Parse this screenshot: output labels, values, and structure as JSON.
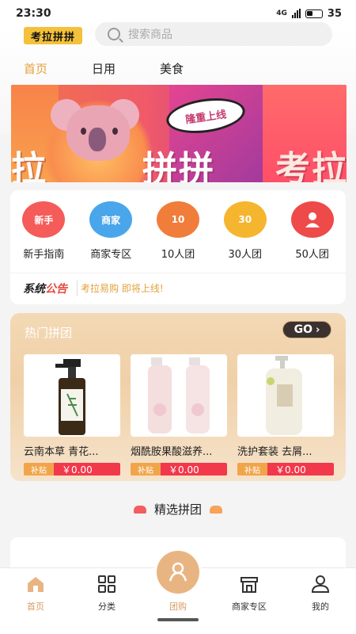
{
  "status_bar": {
    "time": "23:30",
    "network": "4G",
    "battery": "35"
  },
  "header": {
    "logo": "考拉拼拼",
    "search_placeholder": "搜索商品",
    "tabs": [
      {
        "label": "首页",
        "active": true
      },
      {
        "label": "日用",
        "active": false
      },
      {
        "label": "美食",
        "active": false
      }
    ]
  },
  "banner": {
    "bubble_text": "隆重上线",
    "text_left": "拉",
    "text_mid": "拼拼",
    "text_right": "考拉"
  },
  "categories": [
    {
      "label": "新手指南",
      "icon_text": "新手",
      "color": "#f45b59"
    },
    {
      "label": "商家专区",
      "icon_text": "商家",
      "color": "#4aa6ea"
    },
    {
      "label": "10人团",
      "icon_text": "10",
      "color": "#f07d3a"
    },
    {
      "label": "30人团",
      "icon_text": "30",
      "color": "#f5b52e"
    },
    {
      "label": "50人团",
      "icon_text": "",
      "color": "#ee4a4a"
    }
  ],
  "notice": {
    "title_black": "系统",
    "title_red": "公告",
    "text": "考拉易购 即将上线!"
  },
  "hot_group": {
    "title": "热门拼团",
    "go_label": "GO",
    "products": [
      {
        "name": "云南本草 青花...",
        "tag": "补贴",
        "price": "￥0.00"
      },
      {
        "name": "烟酰胺果酸滋养...",
        "tag": "补贴",
        "price": "￥0.00"
      },
      {
        "name": "洗护套装 去屑...",
        "tag": "补贴",
        "price": "￥0.00"
      }
    ]
  },
  "section_title": "精选拼团",
  "bottom_nav": [
    {
      "label": "首页",
      "active": true
    },
    {
      "label": "分类",
      "active": false
    },
    {
      "label": "团购",
      "active": false
    },
    {
      "label": "商家专区",
      "active": false
    },
    {
      "label": "我的",
      "active": false
    }
  ],
  "colors": {
    "accent": "#e2a23b",
    "price_red": "#f2384b",
    "nav_active": "#d59c63"
  }
}
